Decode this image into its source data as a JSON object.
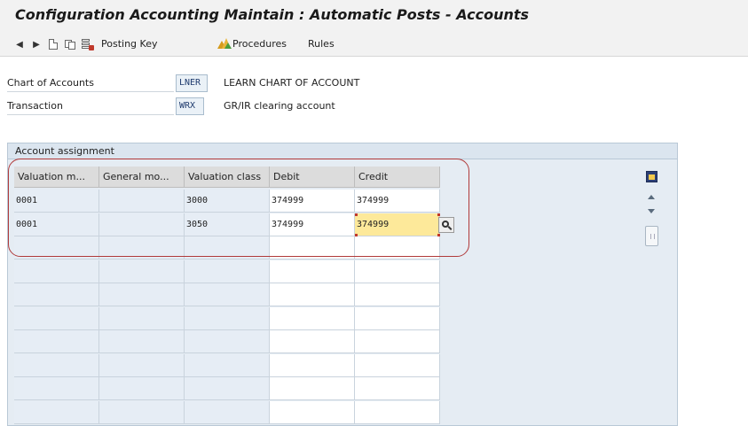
{
  "window": {
    "title": "Configuration Accounting Maintain : Automatic Posts - Accounts"
  },
  "toolbar": {
    "back_icon": "arrow-left-icon",
    "forward_icon": "arrow-right-icon",
    "new_icon": "new-entries-icon",
    "copy_icon": "copy-icon",
    "delete_icon": "delete-icon",
    "posting_key": "Posting Key",
    "procedures": "Procedures",
    "rules": "Rules"
  },
  "header_fields": {
    "chart_of_accounts": {
      "label": "Chart of Accounts",
      "value": "LNER",
      "description": "LEARN CHART OF ACCOUNT"
    },
    "transaction": {
      "label": "Transaction",
      "value": "WRX",
      "description": "GR/IR clearing account"
    }
  },
  "account_assignment": {
    "title": "Account assignment",
    "columns": [
      "Valuation m...",
      "General mo...",
      "Valuation class",
      "Debit",
      "Credit"
    ],
    "rows": [
      [
        "0001",
        "",
        "3000",
        "374999",
        "374999"
      ],
      [
        "0001",
        "",
        "3050",
        "374999",
        "374999"
      ]
    ]
  },
  "colors": {
    "highlight": "#b03a3a",
    "focus_cell": "#fde99a",
    "panel": "#e5ecf3"
  }
}
